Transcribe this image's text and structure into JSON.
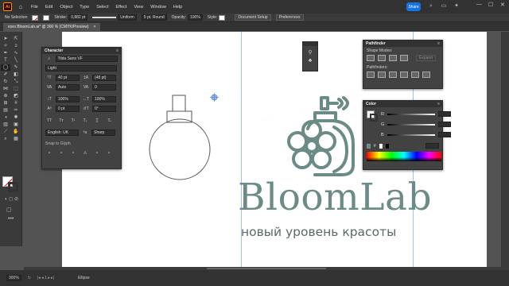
{
  "menubar": {
    "app_logo": "Ai",
    "items": [
      "File",
      "Edit",
      "Object",
      "Type",
      "Select",
      "Effect",
      "View",
      "Window",
      "Help"
    ],
    "share_label": "Share"
  },
  "controlbar": {
    "selection": "No Selection",
    "stroke_label": "Stroke:",
    "stroke_value": "0,882 pt",
    "profile": "Uniform",
    "brush": "5 pt. Round",
    "opacity_label": "Opacity:",
    "opacity_value": "100%",
    "style_label": "Style:",
    "document_setup": "Document Setup",
    "preferences": "Preferences"
  },
  "tab": {
    "title": "eoro BloomLab.ai* @ 300 % (CMYK/Preview)",
    "close": "×"
  },
  "character_panel": {
    "title": "Character",
    "font_family": "Tilda Sans VF",
    "font_style": "Light",
    "font_size": "40 pt",
    "leading": "(48 pt)",
    "kerning": "Auto",
    "tracking": "0",
    "vscale": "100%",
    "hscale": "100%",
    "baseline": "0 pt",
    "rotation": "0°",
    "language": "English: UK",
    "antialias": "Sharp",
    "snap_label": "Snap to Glyph"
  },
  "pathfinder_panel": {
    "title": "Pathfinder",
    "shape_modes": "Shape Modes:",
    "expand": "Expand",
    "pathfinders": "Pathfinders:"
  },
  "color_panel": {
    "title": "Color",
    "channels": [
      "R",
      "G",
      "B"
    ],
    "hash": "#"
  },
  "logo": {
    "title": "BloomLab",
    "subtitle": "новый уровень красоты",
    "color": "#6b8c86"
  },
  "status": {
    "zoom": "300%",
    "tool": "Ellipse"
  }
}
